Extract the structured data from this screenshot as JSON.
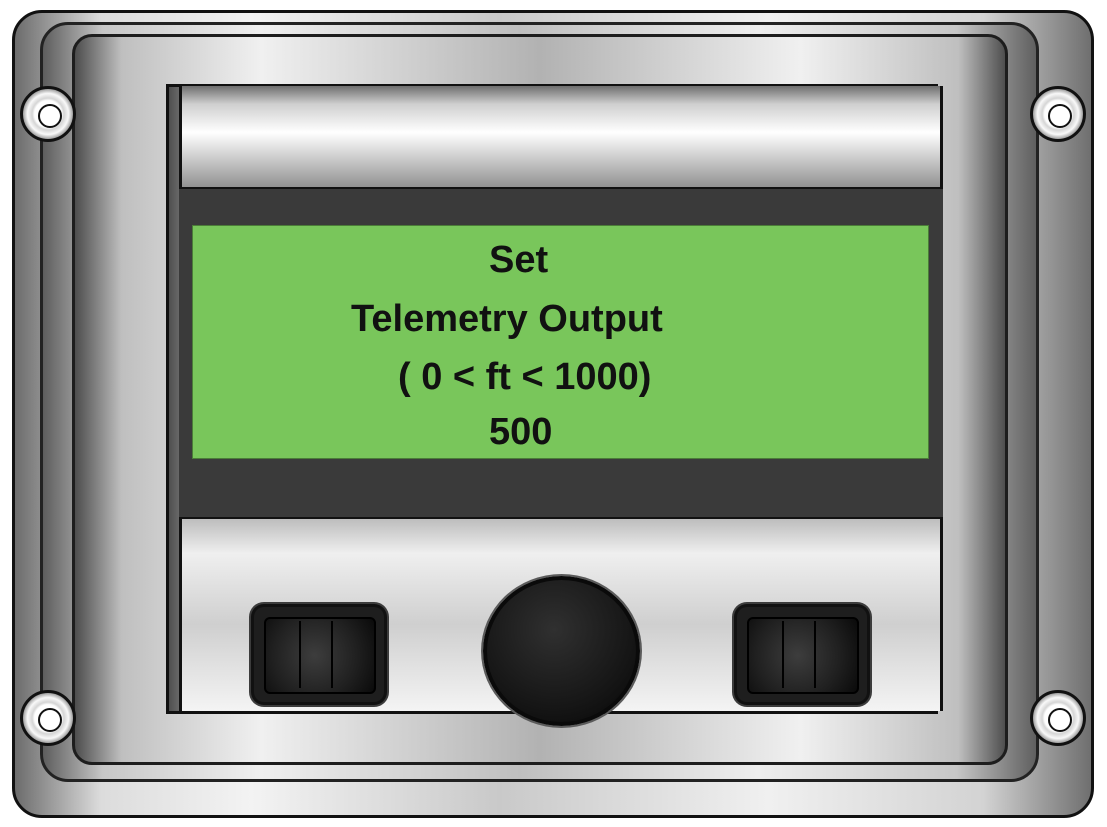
{
  "display": {
    "line_1": "Set",
    "line_2": "Telemetry Output",
    "line_3": "( 0 < ft < 1000)",
    "line_4": "500"
  },
  "colors": {
    "lcd_background": "#79c65b",
    "lcd_text": "#111111",
    "housing_metal": "#d4d4d4",
    "button_black": "#1e1e1e"
  },
  "icons": {
    "left_button": "button-icon",
    "center_button": "button-icon",
    "right_button": "button-icon",
    "mounting_hole": "mounting-hole-icon"
  }
}
